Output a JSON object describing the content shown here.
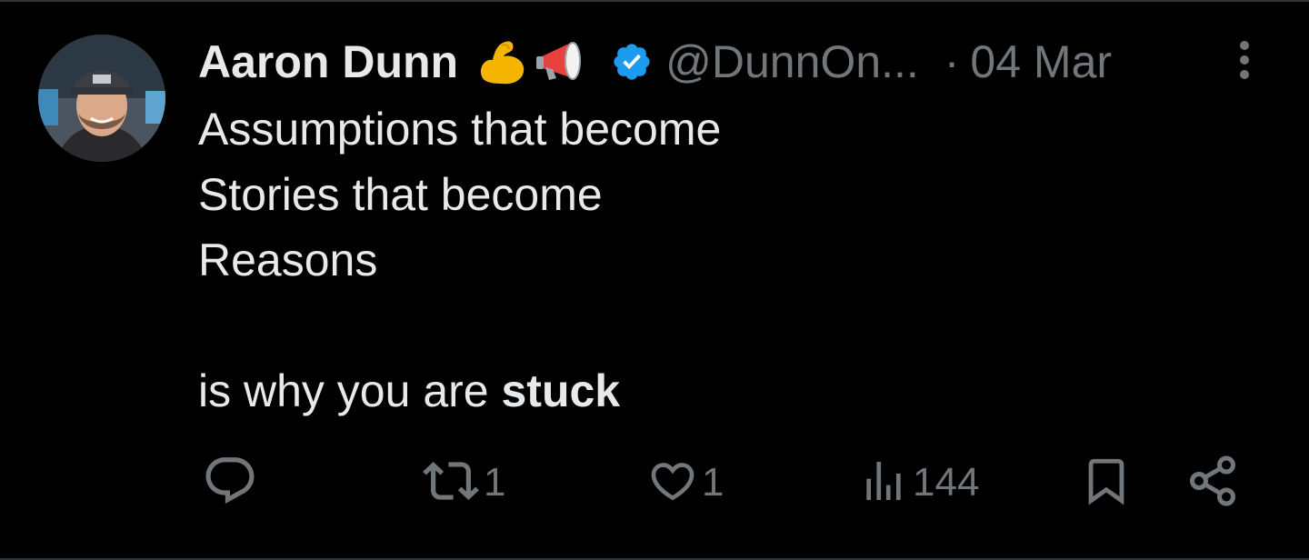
{
  "tweet": {
    "author": {
      "display_name": "Aaron Dunn",
      "emojis": [
        "flexed-biceps-emoji",
        "megaphone-emoji"
      ],
      "verified": true,
      "handle": "@DunnOn...",
      "separator": "·",
      "date": "04 Mar"
    },
    "text": {
      "line1": "Assumptions that become",
      "line2": "Stories that become",
      "line3": "Reasons",
      "line4_prefix": "is why you are ",
      "line4_bold": "stuck"
    },
    "actions": {
      "reply": {
        "icon": "reply-icon",
        "count": ""
      },
      "repost": {
        "icon": "repost-icon",
        "count": "1"
      },
      "like": {
        "icon": "heart-icon",
        "count": "1"
      },
      "views": {
        "icon": "views-icon",
        "count": "144"
      },
      "bookmark": {
        "icon": "bookmark-icon"
      },
      "share": {
        "icon": "share-icon"
      }
    },
    "colors": {
      "background": "#000000",
      "primary_text": "#e7e9ea",
      "secondary_text": "#71767b",
      "verified_blue": "#1d9bf0"
    }
  }
}
